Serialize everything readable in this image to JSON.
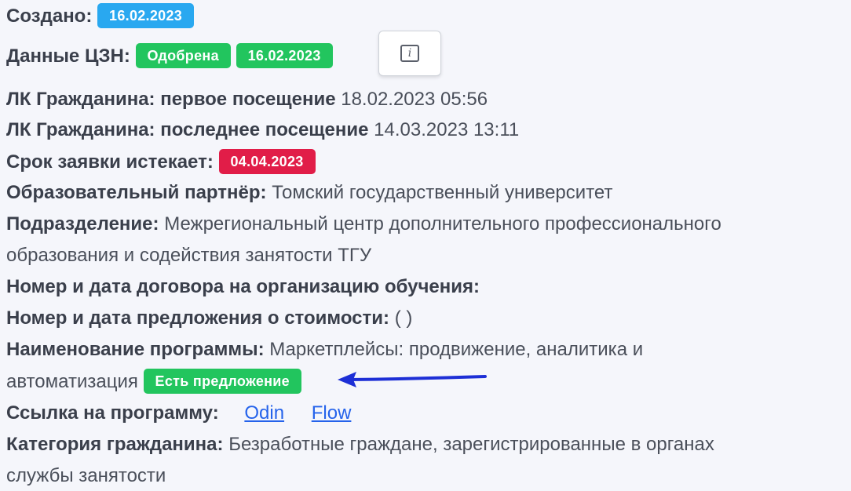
{
  "created": {
    "label": "Создано:",
    "date": "16.02.2023"
  },
  "czn": {
    "label": "Данные ЦЗН:",
    "status": "Одобрена",
    "date": "16.02.2023",
    "info_glyph": "i"
  },
  "first_visit": {
    "label": "ЛК Гражданина: первое посещение",
    "value": "18.02.2023 05:56"
  },
  "last_visit": {
    "label": "ЛК Гражданина: последнее посещение",
    "value": "14.03.2023 13:11"
  },
  "expires": {
    "label": "Срок заявки истекает:",
    "date": "04.04.2023"
  },
  "partner": {
    "label": "Образовательный партнёр:",
    "value": "Томский государственный университет"
  },
  "division": {
    "label": "Подразделение:",
    "value_line1": "Межрегиональный центр дополнительного профессионального",
    "value_line2": "образования и содействия занятости ТГУ"
  },
  "contract": {
    "label": "Номер и дата договора на организацию обучения:"
  },
  "cost_offer": {
    "label": "Номер и дата предложения о стоимости:",
    "value": "( )"
  },
  "program": {
    "label": "Наименование программы:",
    "value_line1": "Маркетплейсы: продвижение, аналитика и",
    "value_line2": "автоматизация",
    "badge": "Есть предложение"
  },
  "program_link": {
    "label": "Ссылка на программу:",
    "link1": "Odin",
    "link2": "Flow"
  },
  "category": {
    "label": "Категория гражданина:",
    "value_line1": "Безработные граждане, зарегистрированные в органах",
    "value_line2": "службы занятости"
  },
  "colors": {
    "badge_blue": "#29a8f0",
    "badge_green": "#22c55e",
    "badge_red": "#e11d48",
    "link": "#2563eb",
    "arrow": "#1d2fd6"
  }
}
